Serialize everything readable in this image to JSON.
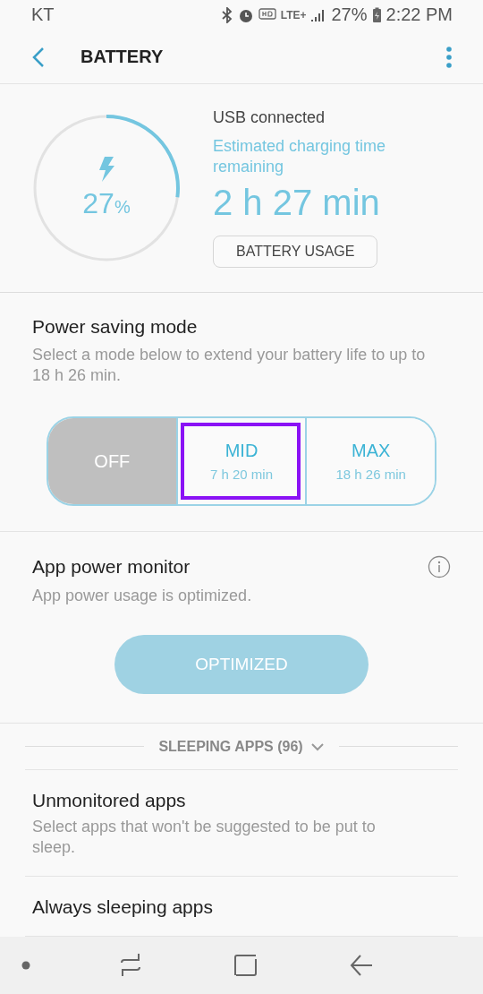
{
  "status_bar": {
    "carrier": "KT",
    "network": "LTE+",
    "battery": "27%",
    "time": "2:22 PM"
  },
  "toolbar": {
    "title": "BATTERY"
  },
  "battery": {
    "level": 0.27,
    "percent": "27",
    "unit": "%",
    "source": "USB connected",
    "estimate_label": "Estimated charging time remaining",
    "estimate": "2 h 27 min",
    "usage_button": "BATTERY USAGE"
  },
  "power_saving": {
    "title": "Power saving mode",
    "description": "Select a mode below to extend your battery life to up to 18 h 26 min.",
    "modes": [
      {
        "label": "OFF",
        "selected": true,
        "focused": false
      },
      {
        "label": "MID",
        "time": "7 h 20 min",
        "selected": false,
        "focused": true
      },
      {
        "label": "MAX",
        "time": "18 h 26 min",
        "selected": false,
        "focused": false
      }
    ]
  },
  "app_power_monitor": {
    "title": "App power monitor",
    "description": "App power usage is optimized.",
    "button": "OPTIMIZED",
    "button_disabled": true
  },
  "sleeping_apps": {
    "label": "SLEEPING APPS (96)",
    "expanded": false
  },
  "items": [
    {
      "title": "Unmonitored apps",
      "description": "Select apps that won't be suggested to be put to sleep."
    },
    {
      "title": "Always sleeping apps"
    }
  ]
}
